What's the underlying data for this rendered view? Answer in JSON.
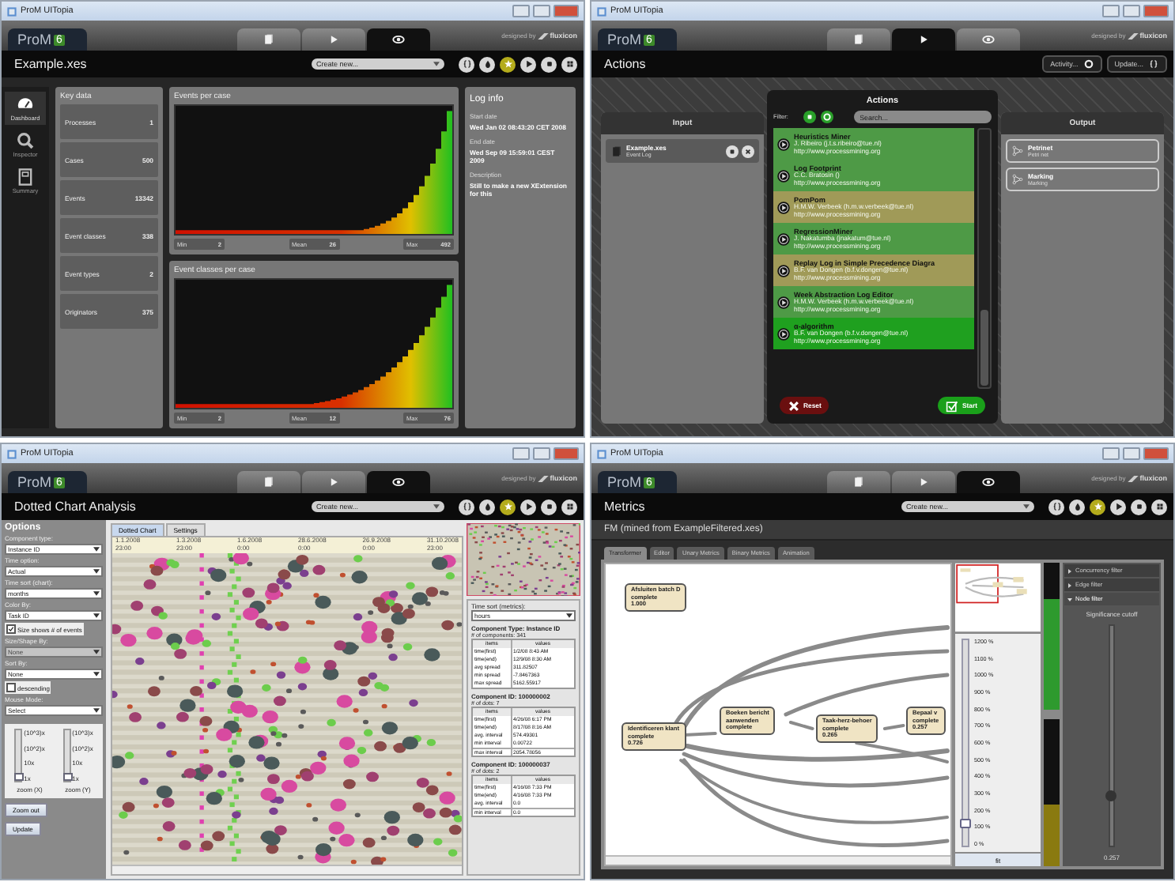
{
  "windows": [
    {
      "kind": "dashboard",
      "title": "ProM UITopia",
      "logo": "ProM",
      "version": "6",
      "credit": "designed by",
      "brand": "fluxicon",
      "tabs": [
        {
          "selected": false
        },
        {
          "selected": false
        },
        {
          "selected": true
        }
      ],
      "heading": "Example.xes",
      "create": "Create new...",
      "tools": [
        {
          "selected": false
        },
        {
          "selected": false
        },
        {
          "selected": true
        },
        {
          "selected": false
        },
        {
          "selected": false
        },
        {
          "selected": false
        }
      ],
      "sidebar": [
        {
          "label": "Dashboard",
          "selected": true
        },
        {
          "label": "Inspector",
          "selected": false
        },
        {
          "label": "Summary",
          "selected": false
        }
      ],
      "key_data": {
        "title": "Key data",
        "items": [
          {
            "label": "Processes",
            "value": "1"
          },
          {
            "label": "Cases",
            "value": "500"
          },
          {
            "label": "Events",
            "value": "13342"
          },
          {
            "label": "Event classes",
            "value": "338"
          },
          {
            "label": "Event types",
            "value": "2"
          },
          {
            "label": "Originators",
            "value": "375"
          }
        ]
      },
      "charts": [
        {
          "title": "Events per case",
          "stats": [
            {
              "label": "Min",
              "value": "2"
            },
            {
              "label": "Mean",
              "value": "26"
            },
            {
              "label": "Max",
              "value": "492"
            }
          ]
        },
        {
          "title": "Event classes per case",
          "stats": [
            {
              "label": "Min",
              "value": "2"
            },
            {
              "label": "Mean",
              "value": "12"
            },
            {
              "label": "Max",
              "value": "76"
            }
          ]
        }
      ],
      "log_info": {
        "title": "Log info",
        "fields": [
          {
            "label": "Start date",
            "value": "Wed Jan 02 08:43:20 CET 2008"
          },
          {
            "label": "End date",
            "value": "Wed Sep 09 15:59:01 CEST 2009"
          },
          {
            "label": "Description",
            "value": "Still to make a new XExtension for this"
          }
        ]
      }
    },
    {
      "kind": "actions",
      "title": "ProM UITopia",
      "logo": "ProM",
      "version": "6",
      "credit": "designed by",
      "brand": "fluxicon",
      "tabs": [
        {
          "selected": false
        },
        {
          "selected": true
        },
        {
          "selected": false
        }
      ],
      "heading": "Actions",
      "buttons": [
        {
          "label": "Activity..."
        },
        {
          "label": "Update..."
        }
      ],
      "input": {
        "title": "Input",
        "items": [
          {
            "name": "Example.xes",
            "type": "Event Log"
          }
        ]
      },
      "dialog": {
        "title": "Actions",
        "filter_label": "Filter:",
        "search_placeholder": "Search...",
        "actions": [
          {
            "name": "Heuristics Miner",
            "author": "J. Ribeiro (j.t.s.ribeiro@tue.nl)",
            "url": "http://www.processmining.org",
            "color": "#4e9a46"
          },
          {
            "name": "Log Footprint",
            "author": "C.C. Bratosin ()",
            "url": "http://www.processmining.org",
            "color": "#4e9a46"
          },
          {
            "name": "PomPom",
            "author": "H.M.W. Verbeek (h.m.w.verbeek@tue.nl)",
            "url": "http://www.processmining.org",
            "color": "#a09a58"
          },
          {
            "name": "RegressionMiner",
            "author": "J. Nakatumba (jnakatum@tue.nl)",
            "url": "http://www.processmining.org",
            "color": "#4e9a46"
          },
          {
            "name": "Replay Log in Simple Precedence Diagra",
            "author": "B.F. van Dongen (b.f.v.dongen@tue.nl)",
            "url": "http://www.processmining.org",
            "color": "#a09a58"
          },
          {
            "name": "Week Abstraction Log Editor",
            "author": "H.M.W. Verbeek (h.m.w.verbeek@tue.nl)",
            "url": "http://www.processmining.org",
            "color": "#4e9a46"
          },
          {
            "name": "α-algorithm",
            "author": "B.F. van Dongen (b.f.v.dongen@tue.nl)",
            "url": "http://www.processmining.org",
            "color": "#1fa01f"
          }
        ],
        "reset": "Reset",
        "start": "Start"
      },
      "output": {
        "title": "Output",
        "items": [
          {
            "name": "Petrinet",
            "type": "Petri net"
          },
          {
            "name": "Marking",
            "type": "Marking"
          }
        ]
      }
    },
    {
      "kind": "dotted",
      "title": "ProM UITopia",
      "logo": "ProM",
      "version": "6",
      "credit": "designed by",
      "brand": "fluxicon",
      "tabs": [
        {
          "selected": false
        },
        {
          "selected": false
        },
        {
          "selected": true
        }
      ],
      "heading": "Dotted Chart Analysis",
      "create": "Create new...",
      "tools": [
        {
          "selected": false
        },
        {
          "selected": false
        },
        {
          "selected": true
        },
        {
          "selected": false
        },
        {
          "selected": false
        },
        {
          "selected": false
        }
      ],
      "options": {
        "title": "Options",
        "controls": [
          {
            "kind": "select",
            "label": "Component type:",
            "value": "Instance ID",
            "disabled": false
          },
          {
            "kind": "select",
            "label": "Time option:",
            "value": "Actual",
            "disabled": false
          },
          {
            "kind": "select",
            "label": "Time sort (chart):",
            "value": "months",
            "disabled": false
          },
          {
            "kind": "select",
            "label": "Color By:",
            "value": "Task ID",
            "disabled": false
          },
          {
            "kind": "checkbox",
            "label": "Size shows # of events",
            "checked": true,
            "disabled": false
          },
          {
            "kind": "select",
            "label": "Size/Shape By:",
            "value": "None",
            "disabled": true
          },
          {
            "kind": "select",
            "label": "Sort By:",
            "value": "None",
            "disabled": false
          },
          {
            "kind": "checkbox",
            "label": "descending",
            "checked": false,
            "disabled": false
          },
          {
            "kind": "select",
            "label": "Mouse Mode:",
            "value": "Select",
            "disabled": false
          }
        ],
        "zooms": [
          {
            "label": "zoom (X)",
            "level": 0,
            "ticks": [
              "(10^3)x",
              "(10^2)x",
              "10x",
              "1x"
            ]
          },
          {
            "label": "zoom (Y)",
            "level": 0,
            "ticks": [
              "(10^3)x",
              "(10^2)x",
              "10x",
              "1x"
            ]
          }
        ],
        "buttons": [
          "Zoom out",
          "Update"
        ]
      },
      "view_tabs": [
        {
          "label": "Dotted Chart",
          "selected": true
        },
        {
          "label": "Settings",
          "selected": false
        }
      ],
      "axis_labels": [
        {
          "date": "1.1.2008",
          "time": "23:00"
        },
        {
          "date": "1.3.2008",
          "time": "23:00"
        },
        {
          "date": "1.6.2008",
          "time": "0:00"
        },
        {
          "date": "28.6.2008",
          "time": "0:00"
        },
        {
          "date": "26.9.2008",
          "time": "0:00"
        },
        {
          "date": "31.10.2008",
          "time": "23:00"
        }
      ],
      "metrics": {
        "sort_label": "Time sort (metrics):",
        "sort_value": "hours",
        "sections": [
          {
            "title": "Component Type: Instance ID",
            "count": "# of components: 341",
            "header": [
              "items",
              "values"
            ],
            "rows": [
              [
                "time(first)",
                "1/2/08 8:43 AM"
              ],
              [
                "time(end)",
                "12/9/08 8:30 AM"
              ],
              [
                "avg spread",
                "311.82507"
              ],
              [
                "min spread",
                "-7.8467363"
              ],
              [
                "max spread",
                "5162.55917"
              ]
            ]
          },
          {
            "title": "Component ID: 100000002",
            "count": "# of dots: 7",
            "header": [
              "items",
              "values"
            ],
            "rows": [
              [
                "time(first)",
                "4/26/08 6:17 PM"
              ],
              [
                "time(end)",
                "8/17/08 8:16 AM"
              ],
              [
                "avg. interval",
                "574.49301"
              ],
              [
                "min interval",
                "0.00722"
              ],
              [
                "max interval",
                "2054.78056"
              ]
            ]
          },
          {
            "title": "Component ID: 100000037",
            "count": "# of dots: 2",
            "header": [
              "items",
              "values"
            ],
            "rows": [
              [
                "time(first)",
                "4/16/08 7:33 PM"
              ],
              [
                "time(end)",
                "4/16/08 7:33 PM"
              ],
              [
                "avg. interval",
                "0.0"
              ],
              [
                "min interval",
                "0.0"
              ]
            ]
          }
        ]
      }
    },
    {
      "kind": "metrics",
      "title": "ProM UITopia",
      "logo": "ProM",
      "version": "6",
      "credit": "designed by",
      "brand": "fluxicon",
      "tabs": [
        {
          "selected": false
        },
        {
          "selected": false
        },
        {
          "selected": true
        }
      ],
      "heading": "Metrics",
      "create": "Create new...",
      "tools": [
        {
          "selected": false
        },
        {
          "selected": false
        },
        {
          "selected": true
        },
        {
          "selected": false
        },
        {
          "selected": false
        },
        {
          "selected": false
        }
      ],
      "subtitle": "FM (mined from ExampleFiltered.xes)",
      "view_tabs": [
        {
          "label": "Transformer",
          "selected": true
        },
        {
          "label": "Editor",
          "selected": false
        },
        {
          "label": "Unary Metrics",
          "selected": false
        },
        {
          "label": "Binary Metrics",
          "selected": false
        },
        {
          "label": "Animation",
          "selected": false
        }
      ],
      "nodes": [
        {
          "lines": [
            "Afsluiten batch D",
            "complete",
            "1.000"
          ]
        },
        {
          "lines": [
            "Identificeren klant",
            "complete",
            "0.726"
          ]
        },
        {
          "lines": [
            "Boeken bericht",
            "aanwenden",
            "complete"
          ]
        },
        {
          "lines": [
            "Taak-herz-behoer",
            "complete",
            "0.265"
          ]
        },
        {
          "lines": [
            "Bepaal v",
            "complete",
            "0.257"
          ]
        }
      ],
      "zoom_scale": [
        "1200 %",
        "1100 %",
        "1000 %",
        "900 %",
        "800 %",
        "700 %",
        "600 %",
        "500 %",
        "400 %",
        "300 %",
        "200 %",
        "100 %",
        "0 %"
      ],
      "zoom": {
        "level": 0.083,
        "fit": "fit"
      },
      "filters": [
        {
          "label": "Concurrency filter",
          "expanded": false
        },
        {
          "label": "Edge filter",
          "expanded": false
        },
        {
          "label": "Node filter",
          "expanded": true
        }
      ],
      "significance": {
        "label": "Significance cutoff",
        "value": "0.257",
        "level": 0.2
      }
    }
  ]
}
